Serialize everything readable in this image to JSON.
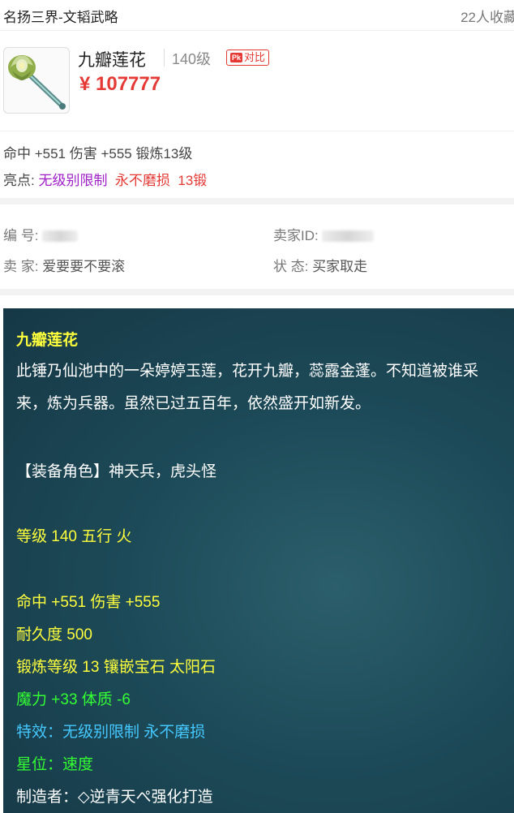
{
  "header": {
    "server": "名扬三界-文韬武略",
    "favorites": "22人收藏"
  },
  "item": {
    "thumbnail_icon": "lotus-mace-icon",
    "name": "九瓣莲花",
    "level": "140级",
    "compare_badge": "Pk",
    "compare_label": "对比",
    "price": "¥ 107777"
  },
  "summary": {
    "stats": "命中 +551 伤害 +555 锻炼13级",
    "highlights_label": "亮点: ",
    "highlights": [
      "无级别限制",
      "永不磨损",
      "13锻"
    ]
  },
  "listing": {
    "number_label": "编 号:",
    "seller_id_label": "卖家ID:",
    "seller_label": "卖 家:",
    "seller_value": "爱要要不要滚",
    "status_label": "状 态:",
    "status_value": "买家取走"
  },
  "description": {
    "title": "九瓣莲花",
    "lore": "此锤乃仙池中的一朵婷婷玉莲，花开九瓣，蕊露金蓬。不知道被谁采来，炼为兵器。虽然已过五百年，依然盛开如新发。",
    "roles": "【装备角色】神天兵，虎头怪",
    "level_element": "等级 140  五行 火",
    "attack": "命中 +551 伤害 +555",
    "durability": "耐久度 500",
    "forge": "锻炼等级 13  镶嵌宝石 太阳石",
    "attributes": "魔力 +33 体质 -6",
    "effects": "特效：无级别限制 永不磨损",
    "star": "星位：速度",
    "maker": "制造者：◇逆青天ぺ强化打造"
  },
  "colors": {
    "price_red": "#e53935",
    "highlight_purple": "#a020c8",
    "panel_bg": "#1d4a58",
    "text_yellow": "#ffff3c",
    "text_green": "#33ff33",
    "text_blue": "#44c8ff"
  }
}
